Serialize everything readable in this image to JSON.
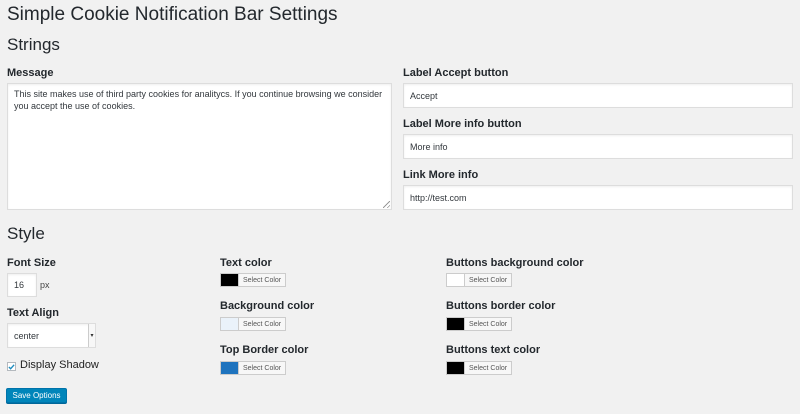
{
  "page": {
    "title": "Simple Cookie Notification Bar Settings"
  },
  "strings": {
    "heading": "Strings",
    "message_label": "Message",
    "message_value": "This site makes use of third party cookies for analitycs. If you continue browsing we consider you accept the use of cookies.",
    "accept_label": "Label Accept button",
    "accept_value": "Accept",
    "more_info_label": "Label More info button",
    "more_info_value": "More info",
    "link_label": "Link More info",
    "link_value": "http://test.com"
  },
  "style": {
    "heading": "Style",
    "font_size_label": "Font Size",
    "font_size_value": "16",
    "font_size_unit": "px",
    "text_align_label": "Text Align",
    "text_align_value": "center",
    "display_shadow_label": "Display Shadow",
    "display_shadow_checked": true,
    "select_color_label": "Select Color",
    "colors": [
      {
        "label": "Text color",
        "value": "#000000"
      },
      {
        "label": "Background color",
        "value": "#eaf2fa"
      },
      {
        "label": "Top Border color",
        "value": "#1e73be"
      },
      {
        "label": "Buttons background color",
        "value": "#ffffff"
      },
      {
        "label": "Buttons border color",
        "value": "#000000"
      },
      {
        "label": "Buttons text color",
        "value": "#000000"
      }
    ]
  },
  "actions": {
    "save_label": "Save Options"
  }
}
